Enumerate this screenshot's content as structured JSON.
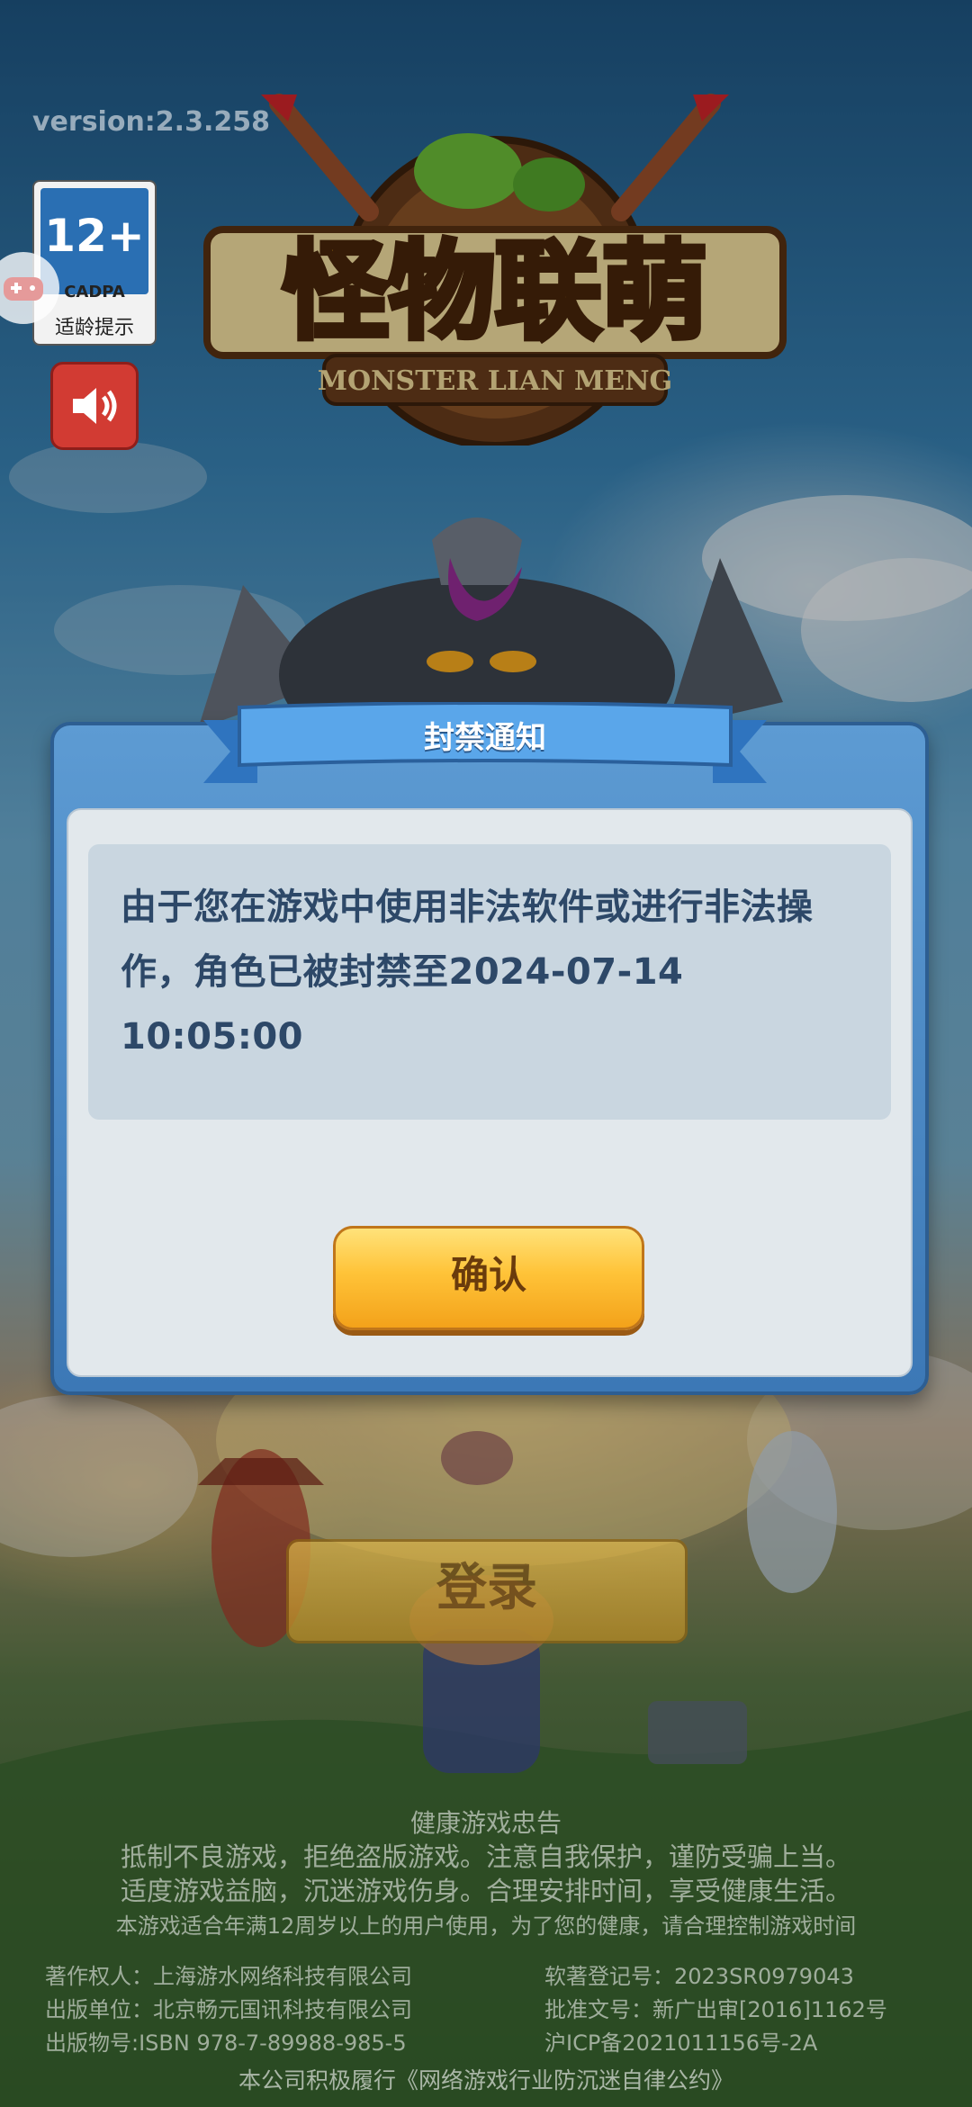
{
  "version": "version:2.3.258",
  "age_badge": {
    "age": "12+",
    "org": "CADPA",
    "tip": "适龄提示"
  },
  "logo": {
    "cn_title": "怪物联萌",
    "en_title": "MONSTER LIAN MENG"
  },
  "dialog": {
    "title": "封禁通知",
    "message": "由于您在游戏中使用非法软件或进行非法操作，角色已被封禁至2024-07-14 10:05:00",
    "confirm_label": "确认"
  },
  "login_label": "登录",
  "health_notice": {
    "heading": "健康游戏忠告",
    "line1": "抵制不良游戏，拒绝盗版游戏。注意自我保护，谨防受骗上当。",
    "line2": "适度游戏益脑，沉迷游戏伤身。合理安排时间，享受健康生活。",
    "age_line": "本游戏适合年满12周岁以上的用户使用，为了您的健康，请合理控制游戏时间"
  },
  "credits": {
    "copyright": "著作权人：上海游水网络科技有限公司",
    "publisher": "出版单位：北京畅元国讯科技有限公司",
    "isbn": "出版物号:ISBN 978-7-89988-985-5",
    "software_reg": "软著登记号：2023SR0979043",
    "approval": "批准文号：新广出审[2016]1162号",
    "icp": "沪ICP备2021011156号-2A"
  },
  "footer": "本公司积极履行《网络游戏行业防沉迷自律公约》",
  "colors": {
    "dialog_blue": "#4a88c4",
    "button_gold": "#ffc338",
    "message_text": "#2d4868"
  }
}
